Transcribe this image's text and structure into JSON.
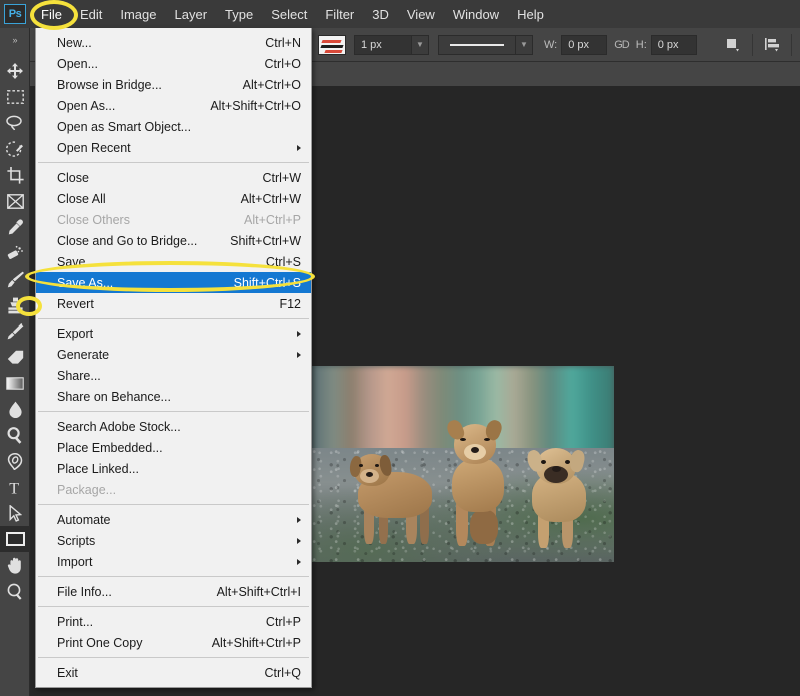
{
  "app": {
    "name": "Adobe Photoshop",
    "logo_text": "Ps"
  },
  "menubar": {
    "items": [
      {
        "label": "File",
        "name": "menu-file",
        "active": true
      },
      {
        "label": "Edit",
        "name": "menu-edit",
        "active": false
      },
      {
        "label": "Image",
        "name": "menu-image",
        "active": false
      },
      {
        "label": "Layer",
        "name": "menu-layer",
        "active": false
      },
      {
        "label": "Type",
        "name": "menu-type",
        "active": false
      },
      {
        "label": "Select",
        "name": "menu-select",
        "active": false
      },
      {
        "label": "Filter",
        "name": "menu-filter",
        "active": false
      },
      {
        "label": "3D",
        "name": "menu-3d",
        "active": false
      },
      {
        "label": "View",
        "name": "menu-view",
        "active": false
      },
      {
        "label": "Window",
        "name": "menu-window",
        "active": false
      },
      {
        "label": "Help",
        "name": "menu-help",
        "active": false
      }
    ]
  },
  "options_bar": {
    "stroke_swatch_icon": "stroke-style-swatch",
    "stroke_width_value": "1 px",
    "stroke_style_icon": "solid-line",
    "width_label": "W:",
    "width_value": "0 px",
    "link_icon": "link-chain-icon",
    "height_label": "H:",
    "height_value": "0 px",
    "path_operations_icon": "path-operations-icon",
    "path_alignment_icon": "path-alignment-icon",
    "path_arrangement_icon": "path-arrangement-icon",
    "settings_icon": "gear-icon"
  },
  "toolbar": {
    "collapse_icon": "double-chevron-right-icon",
    "tools": [
      {
        "name": "move-tool",
        "icon": "move-icon",
        "selected": false
      },
      {
        "name": "rectangular-marquee-tool",
        "icon": "marquee-icon",
        "selected": false
      },
      {
        "name": "lasso-tool",
        "icon": "lasso-icon",
        "selected": false
      },
      {
        "name": "quick-selection-tool",
        "icon": "quick-select-icon",
        "selected": false
      },
      {
        "name": "crop-tool",
        "icon": "crop-icon",
        "selected": false
      },
      {
        "name": "frame-tool",
        "icon": "frame-icon",
        "selected": false
      },
      {
        "name": "eyedropper-tool",
        "icon": "eyedropper-icon",
        "selected": false
      },
      {
        "name": "spot-healing-brush-tool",
        "icon": "healing-brush-icon",
        "selected": false
      },
      {
        "name": "brush-tool",
        "icon": "brush-icon",
        "selected": false
      },
      {
        "name": "clone-stamp-tool",
        "icon": "stamp-icon",
        "selected": false
      },
      {
        "name": "history-brush-tool",
        "icon": "history-brush-icon",
        "selected": false
      },
      {
        "name": "eraser-tool",
        "icon": "eraser-icon",
        "selected": false
      },
      {
        "name": "gradient-tool",
        "icon": "gradient-icon",
        "selected": false
      },
      {
        "name": "blur-tool",
        "icon": "waterdrop-icon",
        "selected": false
      },
      {
        "name": "dodge-tool",
        "icon": "dodge-icon",
        "selected": false
      },
      {
        "name": "pen-tool",
        "icon": "pen-icon",
        "selected": false
      },
      {
        "name": "horizontal-type-tool",
        "icon": "type-t-icon",
        "selected": false
      },
      {
        "name": "path-selection-tool",
        "icon": "arrow-cursor-icon",
        "selected": false
      },
      {
        "name": "rectangle-tool",
        "icon": "rectangle-icon",
        "selected": true
      },
      {
        "name": "hand-tool",
        "icon": "hand-icon",
        "selected": false
      },
      {
        "name": "zoom-tool",
        "icon": "magnifier-icon",
        "selected": false
      }
    ]
  },
  "file_menu": {
    "groups": [
      {
        "items": [
          {
            "label": "New...",
            "accel": "Ctrl+N",
            "submenu": false,
            "disabled": false,
            "highlight": false
          },
          {
            "label": "Open...",
            "accel": "Ctrl+O",
            "submenu": false,
            "disabled": false,
            "highlight": false
          },
          {
            "label": "Browse in Bridge...",
            "accel": "Alt+Ctrl+O",
            "submenu": false,
            "disabled": false,
            "highlight": false
          },
          {
            "label": "Open As...",
            "accel": "Alt+Shift+Ctrl+O",
            "submenu": false,
            "disabled": false,
            "highlight": false
          },
          {
            "label": "Open as Smart Object...",
            "accel": "",
            "submenu": false,
            "disabled": false,
            "highlight": false
          },
          {
            "label": "Open Recent",
            "accel": "",
            "submenu": true,
            "disabled": false,
            "highlight": false
          }
        ]
      },
      {
        "items": [
          {
            "label": "Close",
            "accel": "Ctrl+W",
            "submenu": false,
            "disabled": false,
            "highlight": false
          },
          {
            "label": "Close All",
            "accel": "Alt+Ctrl+W",
            "submenu": false,
            "disabled": false,
            "highlight": false
          },
          {
            "label": "Close Others",
            "accel": "Alt+Ctrl+P",
            "submenu": false,
            "disabled": true,
            "highlight": false
          },
          {
            "label": "Close and Go to Bridge...",
            "accel": "Shift+Ctrl+W",
            "submenu": false,
            "disabled": false,
            "highlight": false
          },
          {
            "label": "Save",
            "accel": "Ctrl+S",
            "submenu": false,
            "disabled": false,
            "highlight": false
          },
          {
            "label": "Save As...",
            "accel": "Shift+Ctrl+S",
            "submenu": false,
            "disabled": false,
            "highlight": true
          },
          {
            "label": "Revert",
            "accel": "F12",
            "submenu": false,
            "disabled": false,
            "highlight": false
          }
        ]
      },
      {
        "items": [
          {
            "label": "Export",
            "accel": "",
            "submenu": true,
            "disabled": false,
            "highlight": false
          },
          {
            "label": "Generate",
            "accel": "",
            "submenu": true,
            "disabled": false,
            "highlight": false
          },
          {
            "label": "Share...",
            "accel": "",
            "submenu": false,
            "disabled": false,
            "highlight": false
          },
          {
            "label": "Share on Behance...",
            "accel": "",
            "submenu": false,
            "disabled": false,
            "highlight": false
          }
        ]
      },
      {
        "items": [
          {
            "label": "Search Adobe Stock...",
            "accel": "",
            "submenu": false,
            "disabled": false,
            "highlight": false
          },
          {
            "label": "Place Embedded...",
            "accel": "",
            "submenu": false,
            "disabled": false,
            "highlight": false
          },
          {
            "label": "Place Linked...",
            "accel": "",
            "submenu": false,
            "disabled": false,
            "highlight": false
          },
          {
            "label": "Package...",
            "accel": "",
            "submenu": false,
            "disabled": true,
            "highlight": false
          }
        ]
      },
      {
        "items": [
          {
            "label": "Automate",
            "accel": "",
            "submenu": true,
            "disabled": false,
            "highlight": false
          },
          {
            "label": "Scripts",
            "accel": "",
            "submenu": true,
            "disabled": false,
            "highlight": false
          },
          {
            "label": "Import",
            "accel": "",
            "submenu": true,
            "disabled": false,
            "highlight": false
          }
        ]
      },
      {
        "items": [
          {
            "label": "File Info...",
            "accel": "Alt+Shift+Ctrl+I",
            "submenu": false,
            "disabled": false,
            "highlight": false
          }
        ]
      },
      {
        "items": [
          {
            "label": "Print...",
            "accel": "Ctrl+P",
            "submenu": false,
            "disabled": false,
            "highlight": false
          },
          {
            "label": "Print One Copy",
            "accel": "Alt+Shift+Ctrl+P",
            "submenu": false,
            "disabled": false,
            "highlight": false
          }
        ]
      },
      {
        "items": [
          {
            "label": "Exit",
            "accel": "Ctrl+Q",
            "submenu": false,
            "disabled": false,
            "highlight": false
          }
        ]
      }
    ]
  },
  "canvas": {
    "document_description": "Photo of three brown puppies standing on a gravel path with blurred colorful background"
  },
  "annotations": {
    "highlight_color": "#f5e13c",
    "selection_color": "#1478d2",
    "ellipses": [
      {
        "name": "file-menu-highlight",
        "target": "File"
      },
      {
        "name": "save-as-highlight",
        "target": "Save As..."
      },
      {
        "name": "eyedropper-highlight",
        "target": "eyedropper-tool"
      }
    ]
  },
  "colors": {
    "menubar_bg": "#3a3a3a",
    "options_bar_bg": "#454545",
    "toolbar_bg": "#454545",
    "canvas_bg": "#262626",
    "menu_bg": "#f1f1f1",
    "accent_blue": "#3aa3d8"
  }
}
